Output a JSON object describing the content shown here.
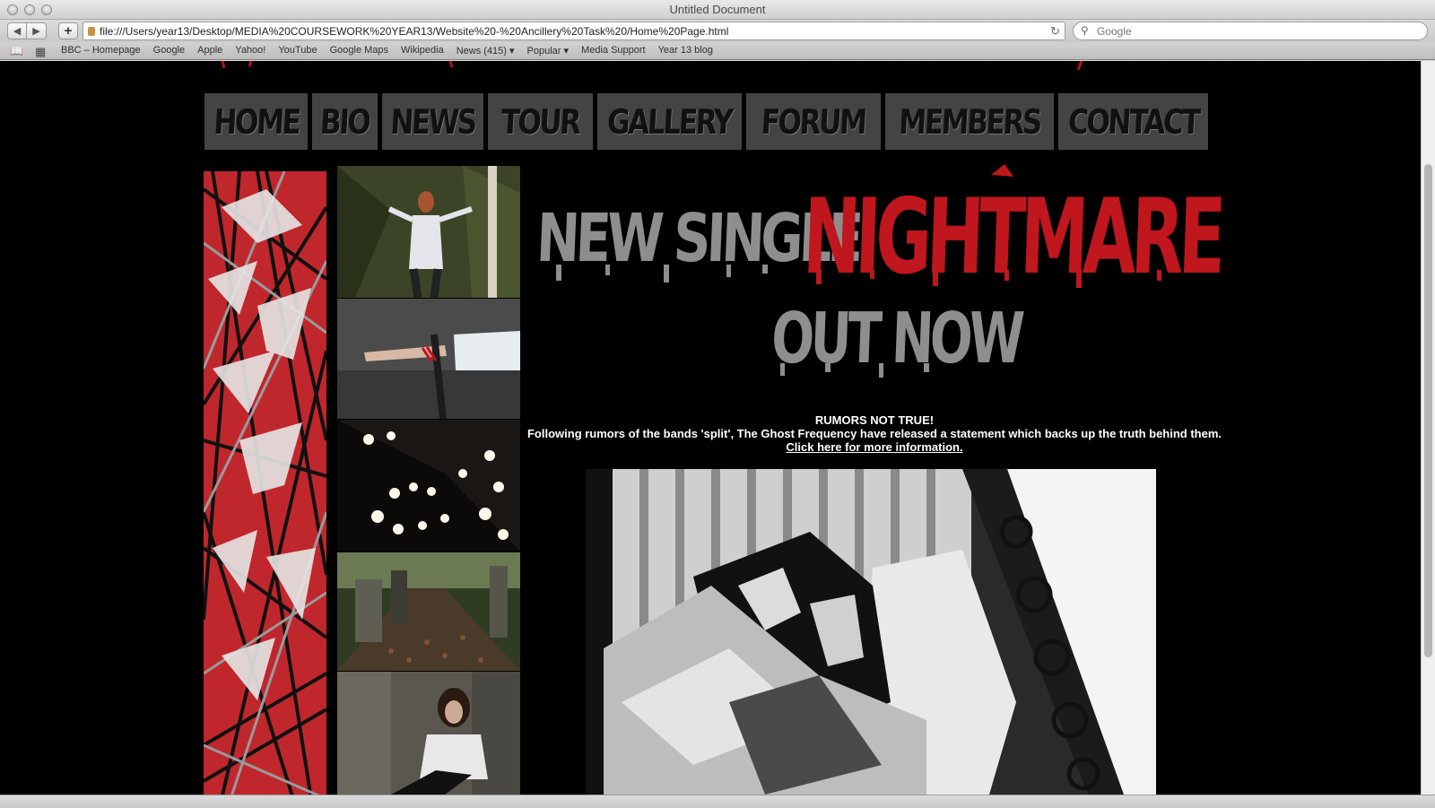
{
  "window": {
    "title": "Untitled Document"
  },
  "toolbar": {
    "url": "file:///Users/year13/Desktop/MEDIA%20COURSEWORK%20YEAR13/Website%20-%20Ancillery%20Task%20/Home%20Page.html",
    "search_placeholder": "Google",
    "back_icon": "back-arrow-icon",
    "forward_icon": "forward-arrow-icon",
    "add_icon": "plus-icon",
    "reload_icon": "reload-icon"
  },
  "bookmarks": {
    "items": [
      {
        "label": "BBC – Homepage"
      },
      {
        "label": "Google"
      },
      {
        "label": "Apple"
      },
      {
        "label": "Yahoo!"
      },
      {
        "label": "YouTube"
      },
      {
        "label": "Google Maps"
      },
      {
        "label": "Wikipedia"
      },
      {
        "label": "News (415) ▾"
      },
      {
        "label": "Popular ▾"
      },
      {
        "label": "Media Support"
      },
      {
        "label": "Year 13 blog"
      }
    ]
  },
  "nav": {
    "items": [
      {
        "label": "HOME"
      },
      {
        "label": "BIO"
      },
      {
        "label": "NEWS"
      },
      {
        "label": "TOUR"
      },
      {
        "label": "GALLERY"
      },
      {
        "label": "FORUM"
      },
      {
        "label": "MEMBERS"
      },
      {
        "label": "CONTACT"
      }
    ]
  },
  "headline": {
    "prefix": "NEW SINGLE",
    "title": "NIGHTMARE",
    "suffix": "OUT NOW"
  },
  "news": {
    "heading": "RUMORS NOT TRUE!",
    "body": "Following rumors of the bands 'split', The Ghost Frequency have released a statement which backs up the truth behind them.",
    "link": "Click here for more information."
  },
  "colors": {
    "page_bg": "#000000",
    "accent_red": "#c0161d",
    "nav_bg": "#444444",
    "text_grey": "#8e8e8e"
  }
}
